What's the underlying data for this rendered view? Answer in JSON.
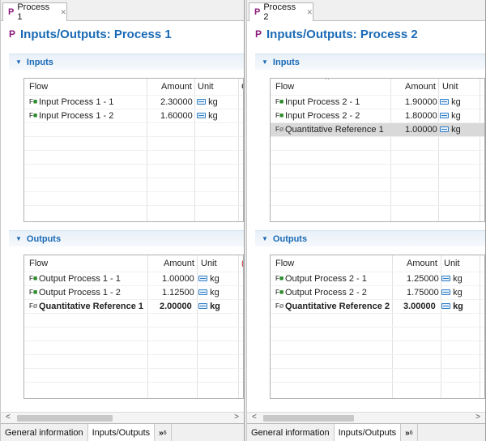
{
  "panels": [
    {
      "tab_label": "Process 1",
      "form_title": "Inputs/Outputs: Process 1",
      "inputs": {
        "section_label": "Inputs",
        "headers": {
          "flow": "Flow",
          "amount": "Amount",
          "unit": "Unit",
          "extra": "C"
        },
        "rows": [
          {
            "flow": "Input Process 1 - 1",
            "amount": "2.30000",
            "unit": "kg"
          },
          {
            "flow": "Input Process 1 - 2",
            "amount": "1.60000",
            "unit": "kg"
          }
        ]
      },
      "outputs": {
        "section_label": "Outputs",
        "headers": {
          "flow": "Flow",
          "amount": "Amount",
          "unit": "Unit",
          "extra": "("
        },
        "rows": [
          {
            "flow": "Output Process 1 - 1",
            "amount": "1.00000",
            "unit": "kg"
          },
          {
            "flow": "Output Process 1 - 2",
            "amount": "1.12500",
            "unit": "kg"
          },
          {
            "flow": "Quantitative Reference 1",
            "amount": "2.00000",
            "unit": "kg"
          }
        ]
      },
      "bottom_tabs": [
        "General information",
        "Inputs/Outputs"
      ],
      "more_tabs": "»",
      "more_count": "6"
    },
    {
      "tab_label": "Process 2",
      "form_title": "Inputs/Outputs: Process 2",
      "inputs": {
        "section_label": "Inputs",
        "headers": {
          "flow": "Flow",
          "amount": "Amount",
          "unit": "Unit",
          "extra": "Co"
        },
        "rows": [
          {
            "flow": "Input Process 2 - 1",
            "amount": "1.90000",
            "unit": "kg"
          },
          {
            "flow": "Input Process 2 - 2",
            "amount": "1.80000",
            "unit": "kg"
          },
          {
            "flow": "Quantitative Reference 1",
            "amount": "1.00000",
            "unit": "kg"
          }
        ]
      },
      "outputs": {
        "section_label": "Outputs",
        "headers": {
          "flow": "Flow",
          "amount": "Amount",
          "unit": "Unit",
          "extra": "C"
        },
        "rows": [
          {
            "flow": "Output Process 2 - 1",
            "amount": "1.25000",
            "unit": "kg"
          },
          {
            "flow": "Output Process 2 - 2",
            "amount": "1.75000",
            "unit": "kg"
          },
          {
            "flow": "Quantitative Reference 2",
            "amount": "3.00000",
            "unit": "kg"
          }
        ]
      },
      "bottom_tabs": [
        "General information",
        "Inputs/Outputs"
      ],
      "more_tabs": "»",
      "more_count": "6"
    }
  ],
  "icons": {
    "process": "P",
    "flow_product": "F",
    "close": "✕",
    "twisty": "▼",
    "scroll_left": "<",
    "scroll_right": ">",
    "sort_up": "^"
  },
  "colors": {
    "accent_blue": "#1a6ab5",
    "process_icon": "#8b1a7a",
    "selected_row": "#d9d9d9"
  }
}
